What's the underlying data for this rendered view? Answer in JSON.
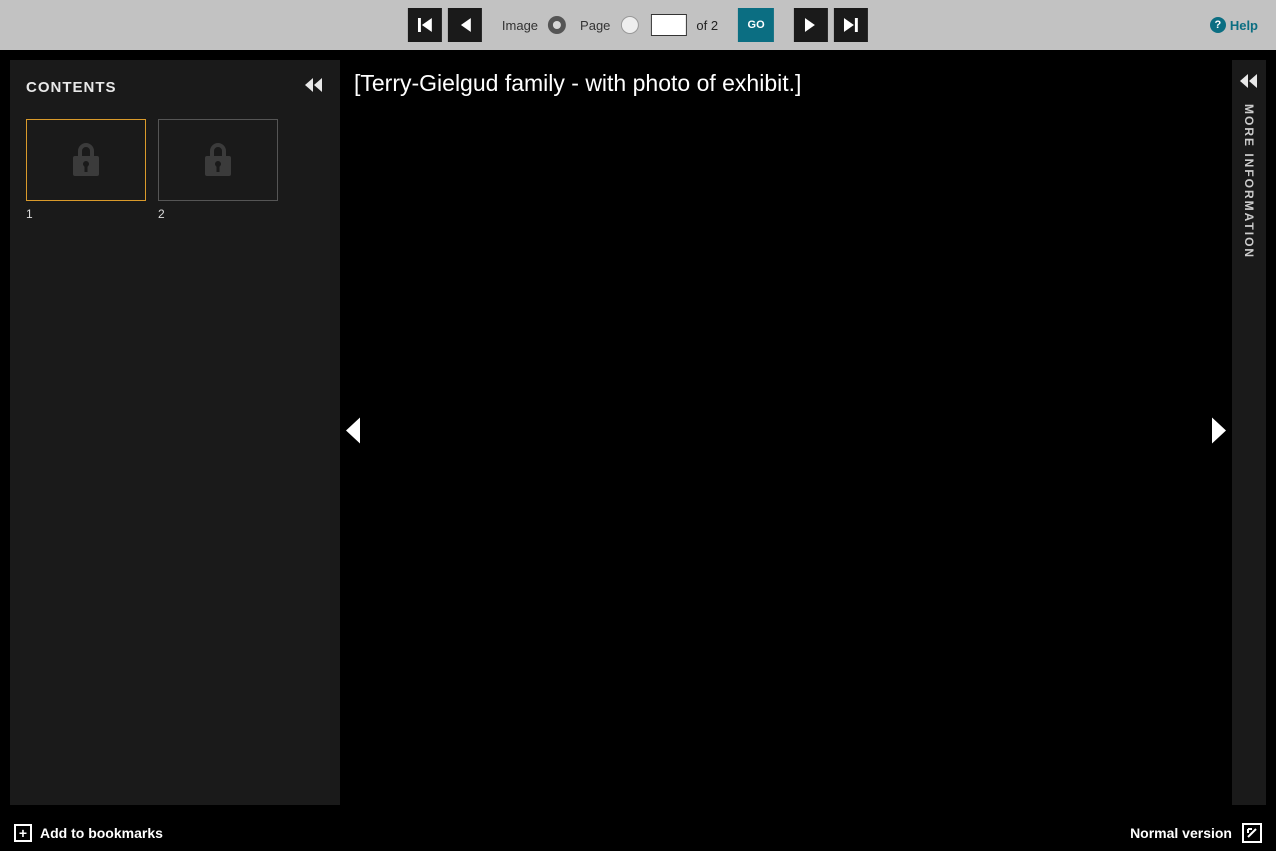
{
  "toolbar": {
    "image_label": "Image",
    "page_label": "Page",
    "page_input_value": "",
    "of_total": "of 2",
    "go_label": "GO",
    "help_label": "Help"
  },
  "contents": {
    "title": "CONTENTS",
    "thumbs": [
      {
        "label": "1",
        "selected": true
      },
      {
        "label": "2",
        "selected": false
      }
    ]
  },
  "viewer": {
    "title": "[Terry-Gielgud family - with photo of exhibit.]"
  },
  "info_panel": {
    "label": "MORE INFORMATION"
  },
  "footer": {
    "bookmark_label": "Add to bookmarks",
    "normal_version_label": "Normal version"
  }
}
